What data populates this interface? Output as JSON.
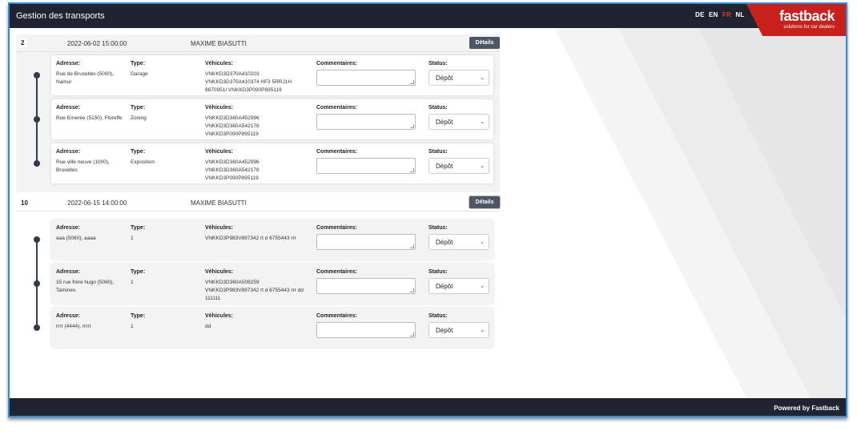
{
  "header": {
    "title": "Gestion des transports",
    "languages": [
      {
        "code": "DE",
        "active": false
      },
      {
        "code": "EN",
        "active": false
      },
      {
        "code": "FR",
        "active": true
      },
      {
        "code": "NL",
        "active": false
      }
    ],
    "logo": {
      "name": "fastback",
      "tagline": "solutions for car dealers"
    },
    "colors": {
      "bar": "#1f2430",
      "active_lang": "#e23b2e",
      "logo_bg": "#c8211b"
    }
  },
  "labels": {
    "address": "Adresse:",
    "type": "Type:",
    "vehicles": "Véhicules:",
    "comments": "Commentaires:",
    "status": "Status:"
  },
  "transports": [
    {
      "number": "2",
      "date": "2022-06-02 15:00:00",
      "driver": "MAXIME BIASUTTI",
      "details_label": "Détails",
      "stops": [
        {
          "address": "Rue de Bruxelles (5000), Namur",
          "type": "Garage",
          "vehicles": "VNKKD3D370A410203 VNKKD3D370A410374 HF3 5RRJ1H 8870951I VNKKD3P090P895119",
          "comment": "",
          "status": "Dépôt"
        },
        {
          "address": "Rue Emerée (5150), Floreffe",
          "type": "Zoning",
          "vehicles": "VNKKD3D360A452996 VNKKD3D360A542178 VNKKD3P090P895119",
          "comment": "",
          "status": "Dépôt"
        },
        {
          "address": "Rue ville neuve (1000), Bruxelles",
          "type": "Exposition",
          "vehicles": "VNKKD3D360A452996 VNKKD3D360A542178 VNKKD3P090P895119",
          "comment": "",
          "status": "Dépôt"
        }
      ]
    },
    {
      "number": "10",
      "date": "2022-06-15 14:00:00",
      "driver": "MAXIME BIASUTTI",
      "details_label": "Détails",
      "stops": [
        {
          "address": "aaa (5060), aaaa",
          "type": "1",
          "vehicles": "VNKKD3P983V897342 rt d 6755443 rrr",
          "comment": "",
          "status": "Dépôt"
        },
        {
          "address": "15 rue frère hugo (5060), Tamines",
          "type": "1",
          "vehicles": "VNKKD3D360A508259 VNKKD3P983V897342 rt d 6755443 rrr dd 111111",
          "comment": "",
          "status": "Dépôt"
        },
        {
          "address": "rrrr (4444), rrrrr",
          "type": "1",
          "vehicles": "dd",
          "comment": "",
          "status": "Dépôt"
        }
      ]
    }
  ],
  "footer": {
    "text": "Powered by Fastback"
  }
}
